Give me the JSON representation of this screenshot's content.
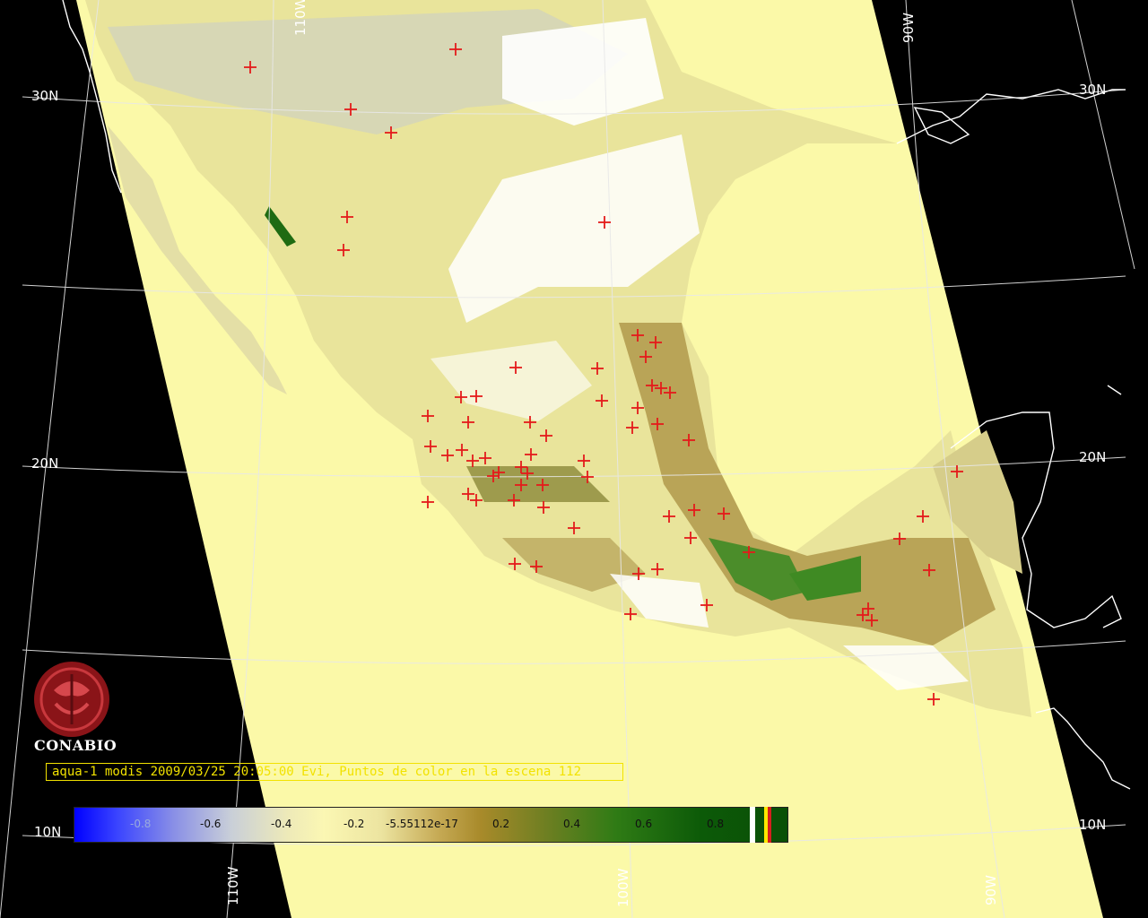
{
  "map": {
    "latitude_labels": [
      "30N",
      "20N",
      "10N"
    ],
    "longitude_labels": [
      "110W",
      "100W",
      "90W"
    ],
    "fire_point_count": 112
  },
  "logo": {
    "name": "CONABIO"
  },
  "caption": {
    "text": "aqua-1 modis 2009/03/25 20:05:00 Evi, Puntos de color en la escena 112"
  },
  "colorbar": {
    "tick_labels": [
      "-0.8",
      "-0.6",
      "-0.4",
      "-0.2",
      "-5.55112e-17",
      "0.2",
      "0.4",
      "0.6",
      "0.8"
    ],
    "low_color": "#0000ff",
    "high_color": "#0a4f06"
  },
  "colors": {
    "background": "#000000",
    "swath": "#fbf9a8",
    "fire_marker": "#e41b1b",
    "caption": "#f2e200"
  }
}
